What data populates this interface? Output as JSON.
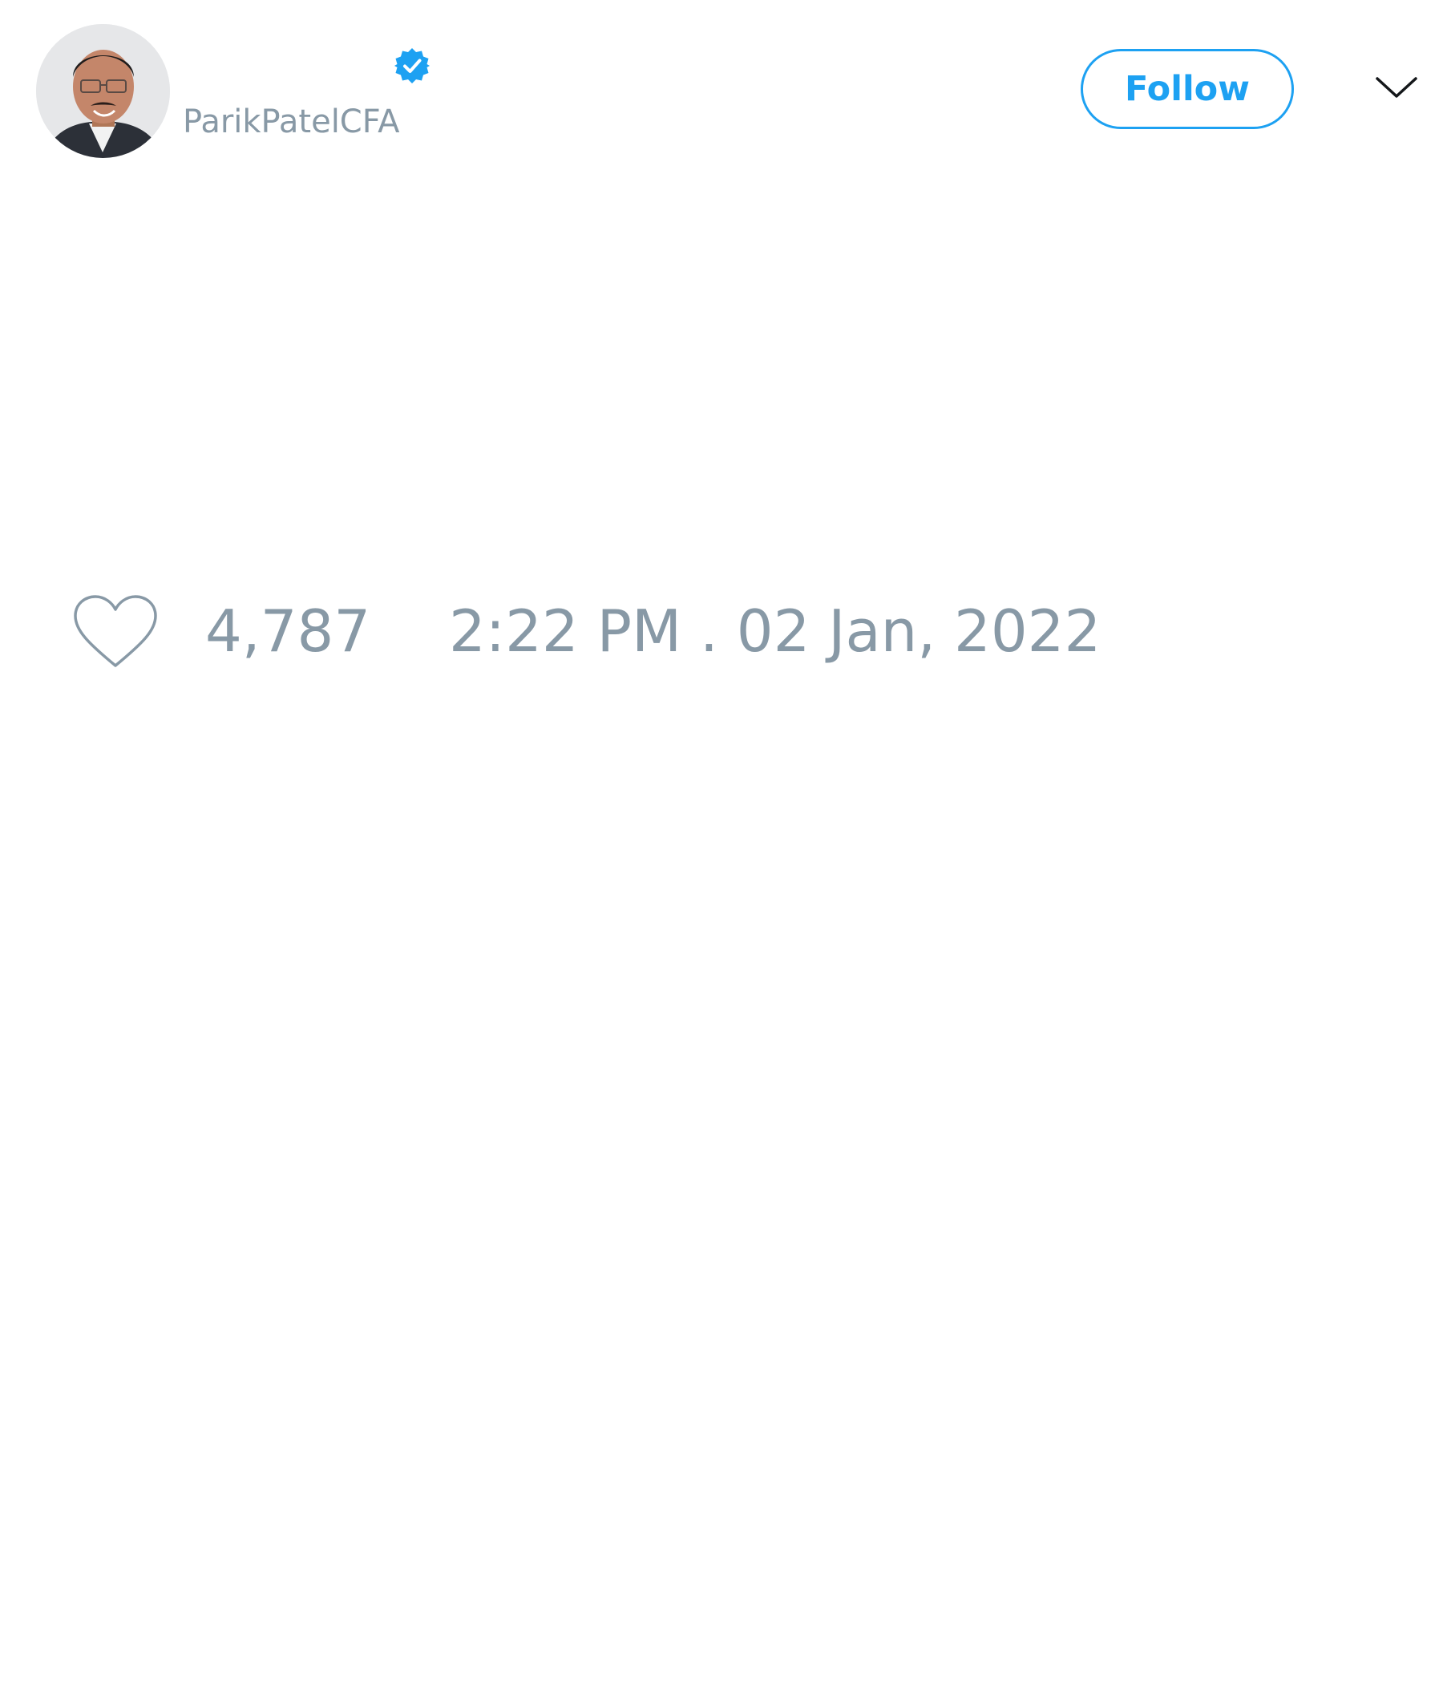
{
  "author": {
    "handle": "ParikPatelCFA",
    "verified": true
  },
  "header": {
    "follow_label": "Follow"
  },
  "stats": {
    "likes": "4,787",
    "timestamp": "2:22 PM . 02 Jan, 2022"
  },
  "colors": {
    "accent": "#1da1f2",
    "muted": "#8899a6",
    "background": "#ffffff"
  },
  "icons": {
    "verified": "verified-badge-icon",
    "more": "chevron-down-icon",
    "like": "heart-icon"
  }
}
